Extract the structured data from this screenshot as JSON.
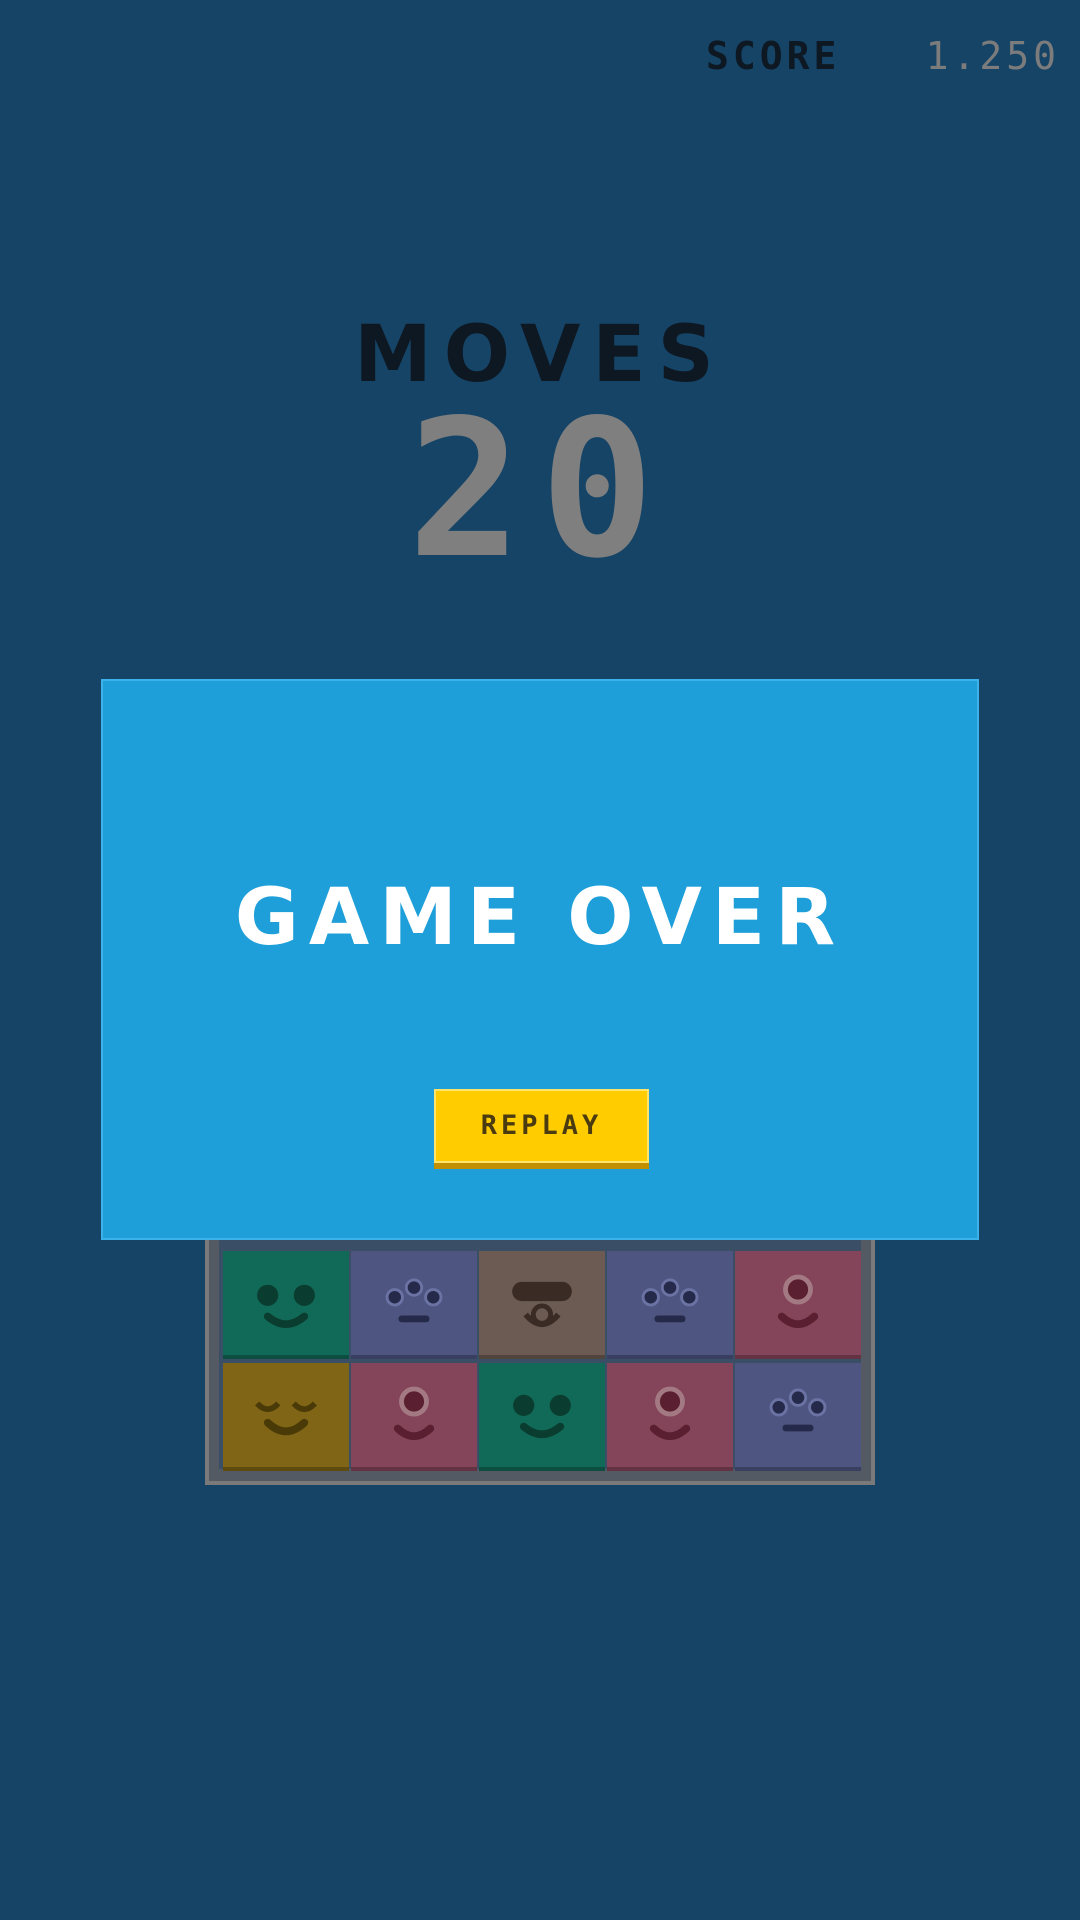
{
  "hud": {
    "score_label": "SCORE",
    "score_value": "1.250",
    "moves_label": "MOVES",
    "moves_value": "20"
  },
  "overlay": {
    "title": "GAME OVER",
    "replay_label": "REPLAY"
  },
  "board": {
    "rows": [
      [
        "green-smile",
        "purple-dots",
        "brown-visor",
        "purple-dots",
        "red-eye"
      ],
      [
        "yellow-sleepy",
        "red-eye",
        "green-smile",
        "red-eye",
        "purple-dots"
      ]
    ]
  },
  "colors": {
    "background": "#164467",
    "overlay": "#1e9fd9",
    "button": "#ffcc00",
    "tile_green": "#116a57",
    "tile_purple": "#4d5580",
    "tile_brown": "#6b5b52",
    "tile_red": "#84455a",
    "tile_yellow": "#7f6515"
  }
}
